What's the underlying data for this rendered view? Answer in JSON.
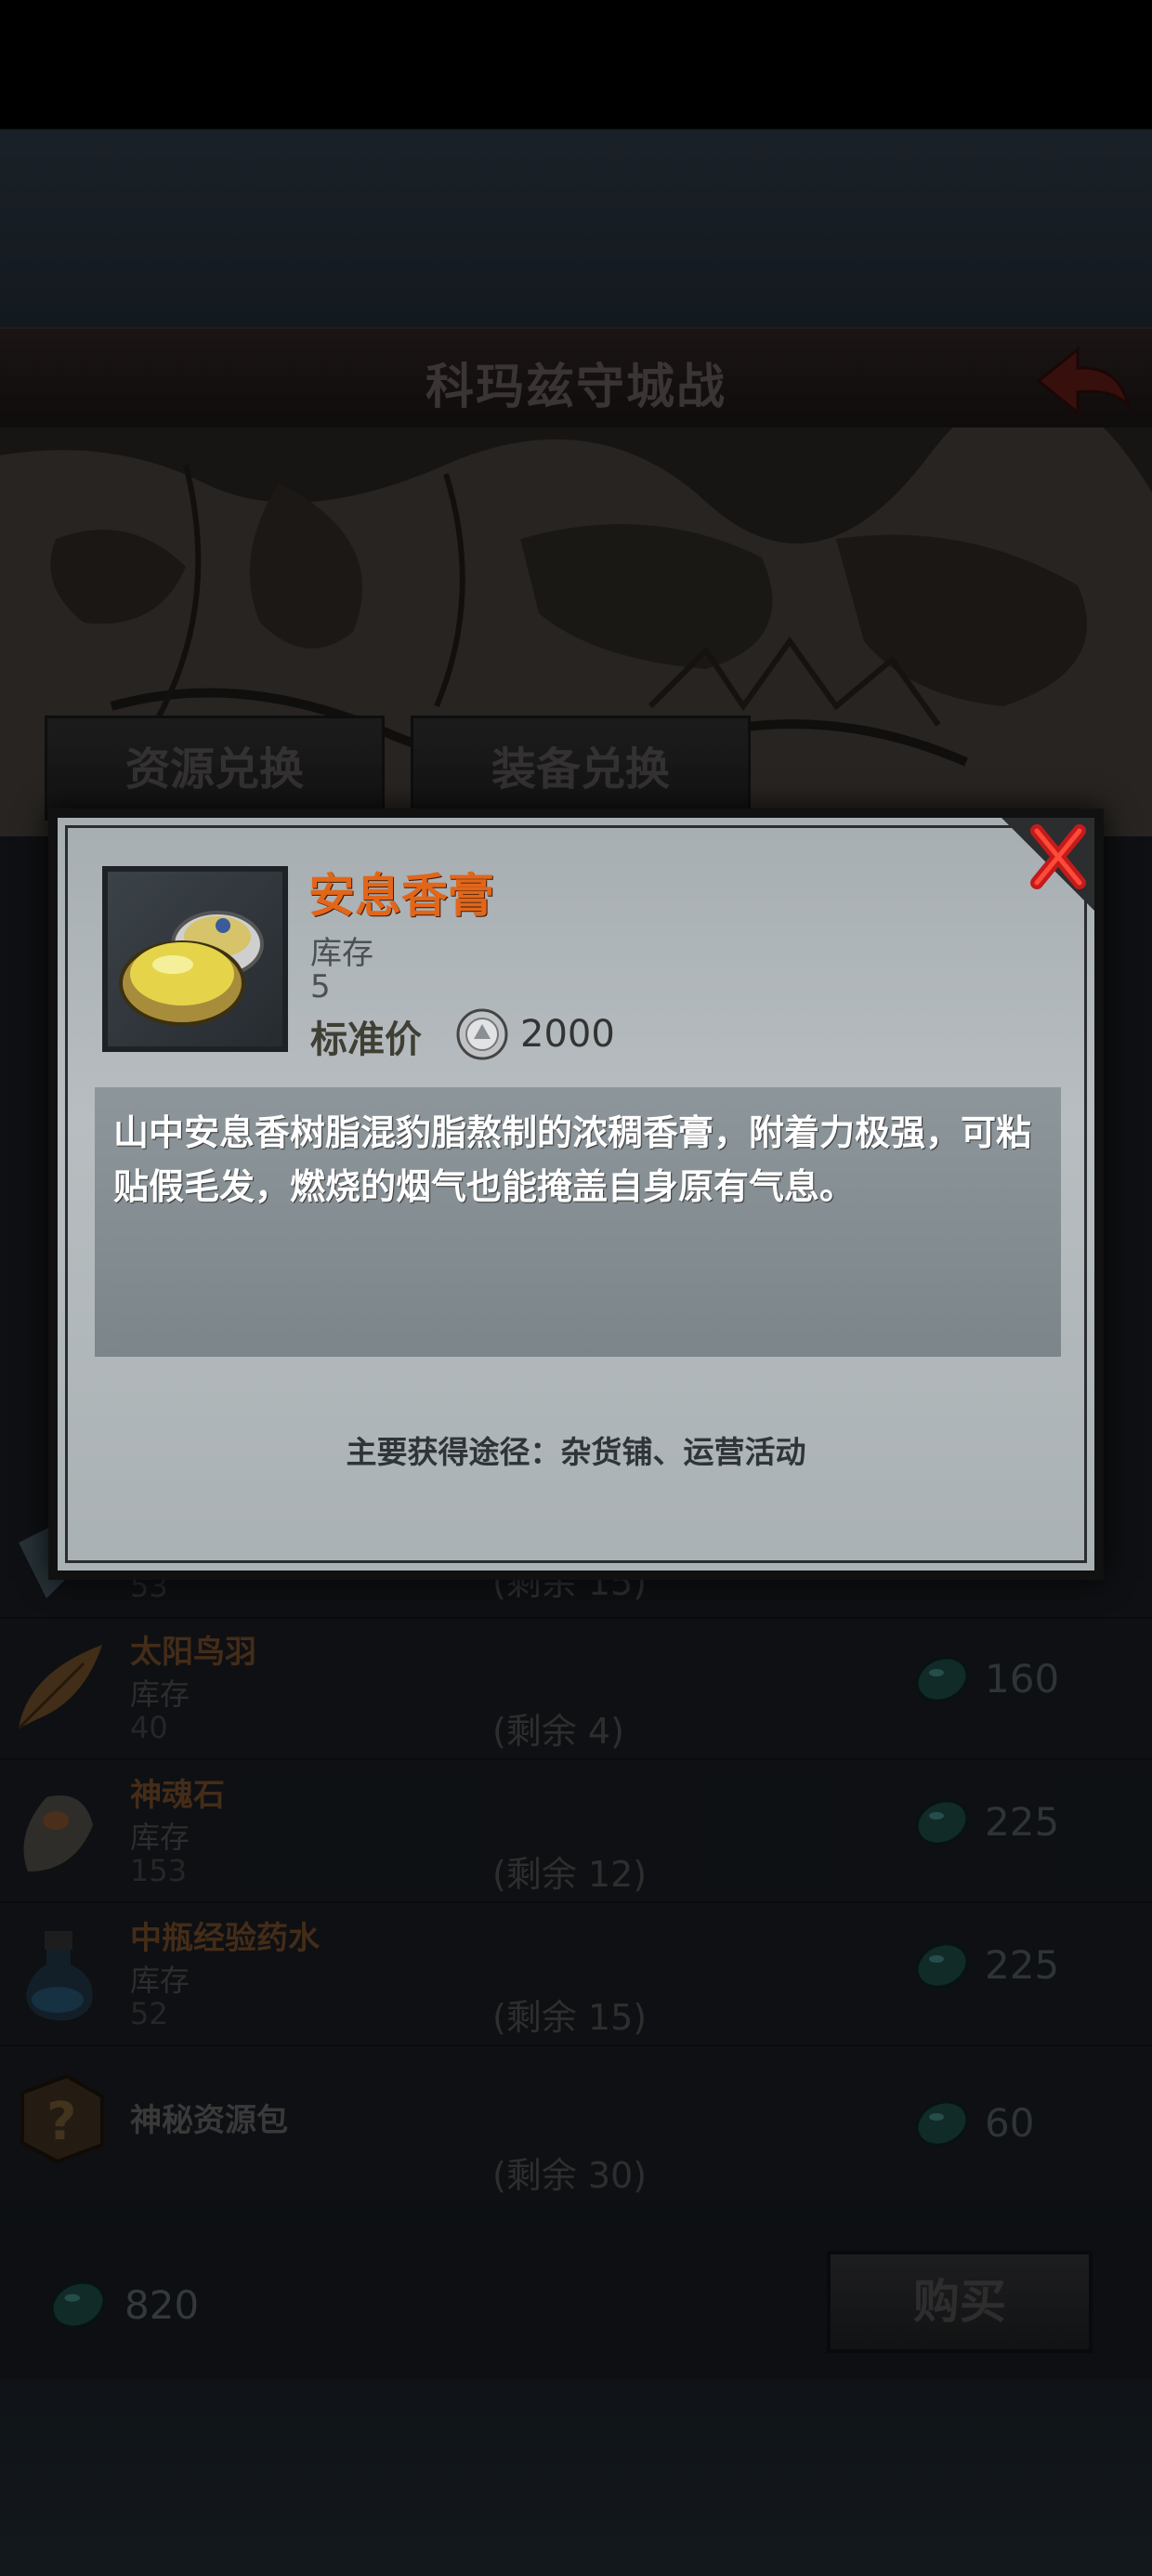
{
  "header": {
    "title": "科玛兹守城战"
  },
  "tabs": [
    {
      "label": "资源兑换"
    },
    {
      "label": "装备兑换"
    }
  ],
  "items": [
    {
      "name": "太阳鸟羽",
      "stock_label": "库存",
      "stock": "40",
      "remain": "(剩余 4)",
      "price": "160",
      "icon": "feather-icon"
    },
    {
      "name": "神魂石",
      "stock_label": "库存",
      "stock": "153",
      "remain": "(剩余 12)",
      "price": "225",
      "icon": "stone-icon"
    },
    {
      "name": "中瓶经验药水",
      "stock_label": "库存",
      "stock": "52",
      "remain": "(剩余 15)",
      "price": "225",
      "icon": "potion-icon"
    },
    {
      "name": "神秘资源包",
      "remain": "(剩余 30)",
      "price": "60",
      "icon": "mystery-box-icon"
    }
  ],
  "partial_row": {
    "stock": "53",
    "remain": "(剩余 15)"
  },
  "footer": {
    "balance": "820",
    "buy_label": "购买"
  },
  "popup": {
    "item_name": "安息香膏",
    "stock_label": "库存",
    "stock": "5",
    "price_label": "标准价",
    "price": "2000",
    "description": "山中安息香树脂混豹脂熬制的浓稠香膏，附着力极强，可粘贴假毛发，燃烧的烟气也能掩盖自身原有气息。",
    "source": "主要获得途径：杂货铺、运营活动"
  },
  "colors": {
    "item_name_accent": "#e2661a",
    "currency_gem": "#1f5d58"
  }
}
